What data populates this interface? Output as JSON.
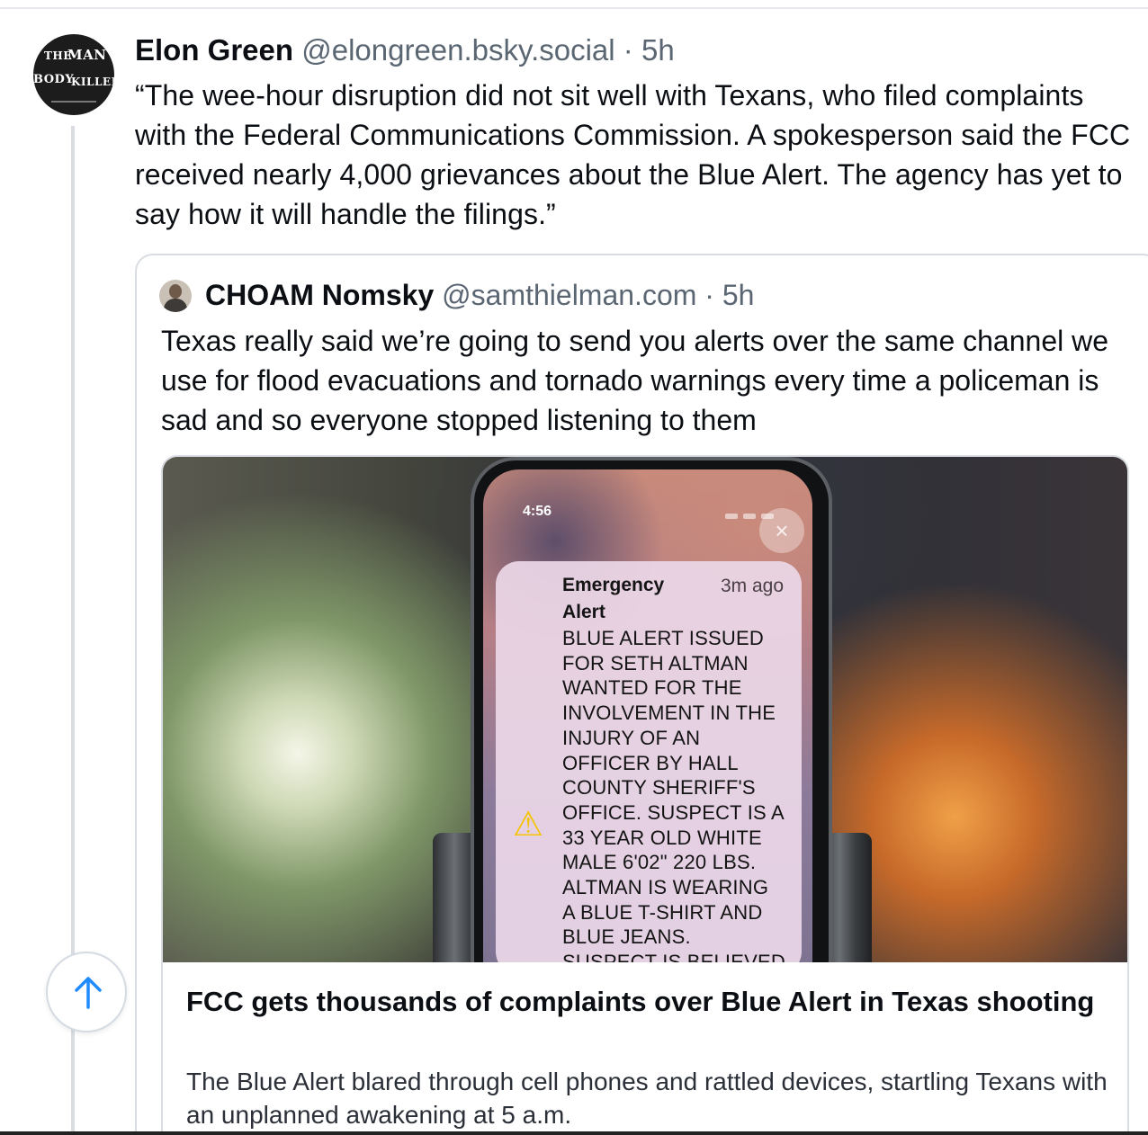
{
  "post": {
    "author_name": "Elon Green",
    "author_handle": "@elongreen.bsky.social",
    "separator": "·",
    "time": "5h",
    "avatar_text": {
      "line1_a": "THE",
      "line1_b": "MAN",
      "line2_a": "BODY",
      "line2_b": "KILLED"
    },
    "text": "“The wee-hour disruption did not sit well with Texans, who filed complaints with the Federal Communications Commission. A spokesperson said the FCC received nearly 4,000 grievances about the Blue Alert. The agency has yet to say how it will handle the filings.”"
  },
  "quote": {
    "author_name": "CHOAM Nomsky",
    "author_handle": "@samthielman.com",
    "separator": "·",
    "time": "5h",
    "text": "Texas really said we’re going to send you alerts over the same channel we use for flood evacuations and tornado warnings every time a policeman is sad and so everyone stopped listening to them"
  },
  "link_card": {
    "title": "FCC gets thousands of complaints over Blue Alert in Texas shooting",
    "description": "The Blue Alert blared through cell phones and rattled devices, startling Texans with an unplanned awakening at 5 a.m."
  },
  "image": {
    "status_time": "4:56",
    "close_glyph": "×",
    "alert_glyph": "⚠",
    "notif_title": "Emergency Alert",
    "notif_time": "3m ago",
    "notif_lines": [
      "BLUE ALERT ISSUED",
      "FOR SETH ALTMAN",
      "WANTED FOR THE",
      "INVOLVEMENT IN THE",
      "INJURY OF AN",
      "OFFICER BY HALL",
      "COUNTY SHERIFF'S",
      "OFFICE. SUSPECT IS A",
      "33 YEAR OLD WHITE",
      "MALE 6'02\" 220 LBS.",
      "ALTMAN IS WEARING",
      "A BLUE T-SHIRT AND",
      "BLUE JEANS.",
      "SUSPECT IS BELIEVED"
    ]
  },
  "controls": {
    "scroll_top_icon": "arrow-up-icon"
  },
  "colors": {
    "text_primary": "#0b0f14",
    "text_secondary": "#5b6673",
    "border": "#d9dde2",
    "accent": "#208bfe"
  }
}
